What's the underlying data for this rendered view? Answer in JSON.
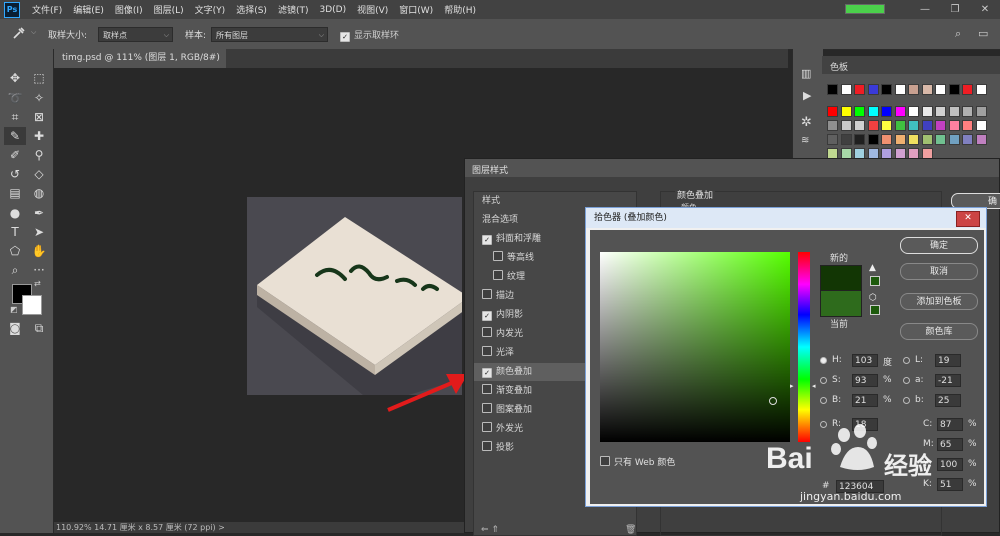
{
  "menubar": {
    "items": [
      "文件(F)",
      "编辑(E)",
      "图像(I)",
      "图层(L)",
      "文字(Y)",
      "选择(S)",
      "滤镜(T)",
      "3D(D)",
      "视图(V)",
      "窗口(W)",
      "帮助(H)"
    ],
    "minimize": "—",
    "restore": "❐",
    "close": "✕",
    "progress_percent": 100
  },
  "options": {
    "sample_size_label": "取样大小:",
    "sample_size_value": "取样点",
    "sample_label": "样本:",
    "sample_value": "所有图层",
    "show_ring_label": "显示取样环"
  },
  "document": {
    "tab_title": "timg.psd @ 111% (图层 1, RGB/8#) *",
    "status": "110.92%    14.71 厘米 x 8.57 厘米 (72 ppi)    >"
  },
  "swatches_panel": {
    "title": "色板",
    "row0": [
      "#000000",
      "#ffffff",
      "#ee1d24",
      "#3a3ad8",
      "#000000",
      "#ffffff",
      "#c8a090",
      "#d8b8a8",
      "#ffffff",
      "#000000",
      "#ee1d24",
      "#ffffff"
    ],
    "row1": [
      "#ff0000",
      "#ffff00",
      "#00ff00",
      "#00ffff",
      "#0000ff",
      "#ff00ff",
      "#ffffff",
      "#e8e8e8",
      "#d0d0d0",
      "#c0c0c0",
      "#b0b0b0",
      "#a0a0a0"
    ],
    "row2": [
      "#909090",
      "#c8c8c8",
      "#d0d0d0",
      "#f04040",
      "#ffff40",
      "#40c040",
      "#40c0c0",
      "#4040c0",
      "#c040c0",
      "#ff80a0",
      "#ff8080",
      "#ffffff"
    ],
    "row3": [
      "#606060",
      "#404040",
      "#202020",
      "#000000",
      "#f09070",
      "#f0b070",
      "#f0e060",
      "#a0c070",
      "#70c090",
      "#70a0c0",
      "#8080c0",
      "#c080c0"
    ],
    "row4": [
      "#c0d890",
      "#a8d8a8",
      "#a0d0e0",
      "#a0b8e0",
      "#b0a0e0",
      "#d0a0d0",
      "#e0a0c0",
      "#f0a0a0"
    ]
  },
  "layer_style": {
    "title": "图层样式",
    "list": [
      {
        "label": "样式",
        "check": null
      },
      {
        "label": "混合选项",
        "check": null
      },
      {
        "label": "斜面和浮雕",
        "check": true
      },
      {
        "label": "等高线",
        "check": false,
        "indent": true
      },
      {
        "label": "纹理",
        "check": false,
        "indent": true
      },
      {
        "label": "描边",
        "check": false
      },
      {
        "label": "内阴影",
        "check": true
      },
      {
        "label": "内发光",
        "check": false
      },
      {
        "label": "光泽",
        "check": false
      },
      {
        "label": "颜色叠加",
        "check": true,
        "selected": true
      },
      {
        "label": "渐变叠加",
        "check": false
      },
      {
        "label": "图案叠加",
        "check": false
      },
      {
        "label": "外发光",
        "check": false
      },
      {
        "label": "投影",
        "check": false
      }
    ],
    "section_title": "颜色叠加",
    "section_sub": "颜色",
    "ok_partial": "确"
  },
  "color_picker": {
    "title": "拾色器 (叠加颜色)",
    "new_label": "新的",
    "current_label": "当前",
    "new_color": "#123604",
    "current_color": "#2e6b1c",
    "ok": "确定",
    "cancel": "取消",
    "add_to_swatches": "添加到色板",
    "color_libraries": "颜色库",
    "only_web": "只有 Web 颜色",
    "H": "103",
    "H_unit": "度",
    "S": "93",
    "S_unit": "%",
    "B": "21",
    "B_unit": "%",
    "R": "18",
    "L": "19",
    "a": "-21",
    "b": "25",
    "C": "87",
    "M": "65",
    "Y": "100",
    "K": "51",
    "C_unit": "%",
    "M_unit": "%",
    "Y_unit": "%",
    "K_unit": "%",
    "hex_label": "#",
    "hex": "123604"
  },
  "watermark": {
    "brand": "Bai",
    "brand2": "经验",
    "url": "jingyan.baidu.com"
  }
}
